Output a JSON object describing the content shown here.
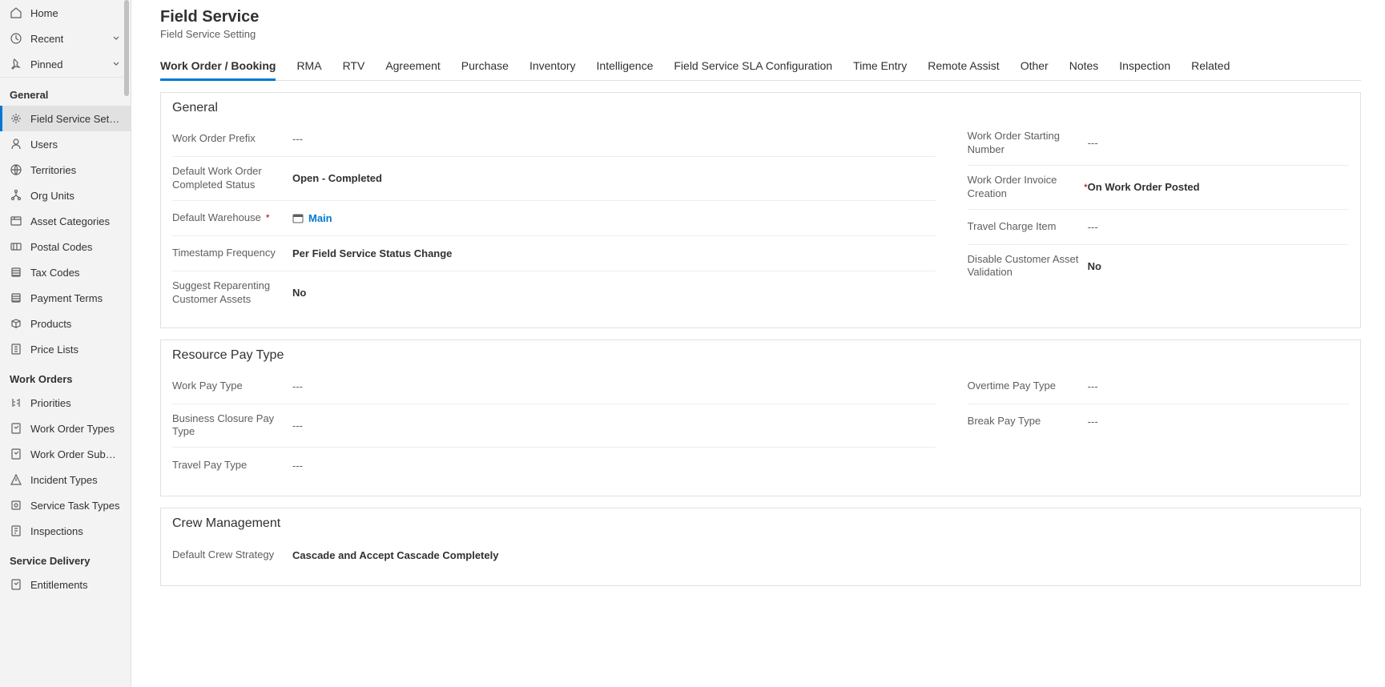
{
  "nav": {
    "top": [
      {
        "icon": "home",
        "label": "Home"
      },
      {
        "icon": "clock",
        "label": "Recent",
        "chevron": true
      },
      {
        "icon": "pin",
        "label": "Pinned",
        "chevron": true
      }
    ],
    "groups": [
      {
        "title": "General",
        "items": [
          {
            "icon": "gear",
            "label": "Field Service Setti...",
            "active": true
          },
          {
            "icon": "user",
            "label": "Users"
          },
          {
            "icon": "globe",
            "label": "Territories"
          },
          {
            "icon": "org",
            "label": "Org Units"
          },
          {
            "icon": "asset",
            "label": "Asset Categories"
          },
          {
            "icon": "postal",
            "label": "Postal Codes"
          },
          {
            "icon": "tax",
            "label": "Tax Codes"
          },
          {
            "icon": "payment",
            "label": "Payment Terms"
          },
          {
            "icon": "product",
            "label": "Products"
          },
          {
            "icon": "pricelist",
            "label": "Price Lists"
          }
        ]
      },
      {
        "title": "Work Orders",
        "items": [
          {
            "icon": "priority",
            "label": "Priorities"
          },
          {
            "icon": "wotype",
            "label": "Work Order Types"
          },
          {
            "icon": "wosubst",
            "label": "Work Order Subst..."
          },
          {
            "icon": "incident",
            "label": "Incident Types"
          },
          {
            "icon": "servicetask",
            "label": "Service Task Types"
          },
          {
            "icon": "inspection",
            "label": "Inspections"
          }
        ]
      },
      {
        "title": "Service Delivery",
        "items": [
          {
            "icon": "entitlement",
            "label": "Entitlements"
          }
        ]
      }
    ]
  },
  "header": {
    "title": "Field Service",
    "subtitle": "Field Service Setting"
  },
  "tabs": [
    "Work Order / Booking",
    "RMA",
    "RTV",
    "Agreement",
    "Purchase",
    "Inventory",
    "Intelligence",
    "Field Service SLA Configuration",
    "Time Entry",
    "Remote Assist",
    "Other",
    "Notes",
    "Inspection",
    "Related"
  ],
  "activeTab": 0,
  "sections": {
    "general": {
      "title": "General",
      "left": [
        {
          "label": "Work Order Prefix",
          "value": "---",
          "valueType": "muted"
        },
        {
          "label": "Default Work Order Completed Status",
          "value": "Open - Completed",
          "valueType": "bold"
        },
        {
          "label": "Default Warehouse",
          "required": true,
          "value": "Main",
          "valueType": "link",
          "lookup": true
        },
        {
          "label": "Timestamp Frequency",
          "value": "Per Field Service Status Change",
          "valueType": "bold"
        },
        {
          "label": "Suggest Reparenting Customer Assets",
          "value": "No",
          "valueType": "bold"
        }
      ],
      "right": [
        {
          "label": "Work Order Starting Number",
          "value": "---",
          "valueType": "muted"
        },
        {
          "label": "Work Order Invoice Creation",
          "required": true,
          "value": "On Work Order Posted",
          "valueType": "bold"
        },
        {
          "label": "Travel Charge Item",
          "value": "---",
          "valueType": "muted"
        },
        {
          "label": "Disable Customer Asset Validation",
          "value": "No",
          "valueType": "bold"
        }
      ]
    },
    "resourcePay": {
      "title": "Resource Pay Type",
      "left": [
        {
          "label": "Work Pay Type",
          "value": "---",
          "valueType": "muted"
        },
        {
          "label": "Business Closure Pay Type",
          "value": "---",
          "valueType": "muted"
        },
        {
          "label": "Travel Pay Type",
          "value": "---",
          "valueType": "muted"
        }
      ],
      "right": [
        {
          "label": "Overtime Pay Type",
          "value": "---",
          "valueType": "muted"
        },
        {
          "label": "Break Pay Type",
          "value": "---",
          "valueType": "muted"
        }
      ]
    },
    "crew": {
      "title": "Crew Management",
      "left": [
        {
          "label": "Default Crew Strategy",
          "value": "Cascade and Accept Cascade Completely",
          "valueType": "bold"
        }
      ],
      "right": []
    }
  }
}
